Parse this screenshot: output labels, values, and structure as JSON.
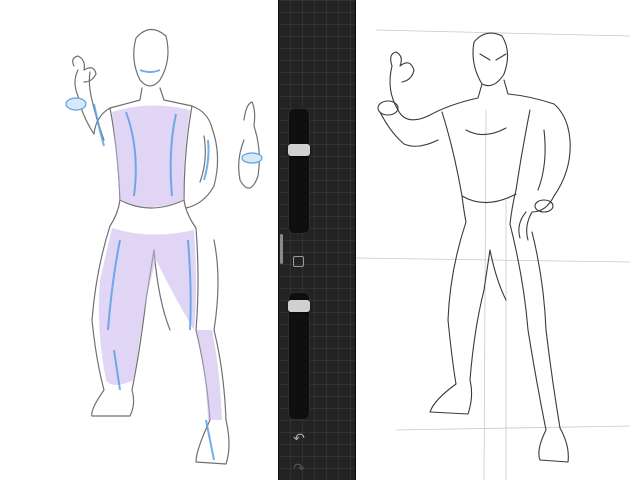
{
  "app": {
    "colors": {
      "canvas": "#ffffff",
      "toolbar": "#232323",
      "slider_thumb": "#d0d0d0",
      "pencil_line": "#555555",
      "ink_blue": "#5aa0e6",
      "ink_purple": "#b89ce0"
    }
  },
  "left_canvas": {
    "artwork": "colored-superhero-sketch"
  },
  "right_canvas": {
    "artwork": "pencil-superhero-sketch"
  },
  "toolbar": {
    "size_slider": {
      "level": 0.68
    },
    "opacity_slider": {
      "level": 0.93
    },
    "modify_icon": "square-icon",
    "undo_icon": "undo-arrow-icon",
    "redo_icon": "redo-arrow-icon",
    "undo_glyph": "↶",
    "redo_glyph": "↷"
  }
}
